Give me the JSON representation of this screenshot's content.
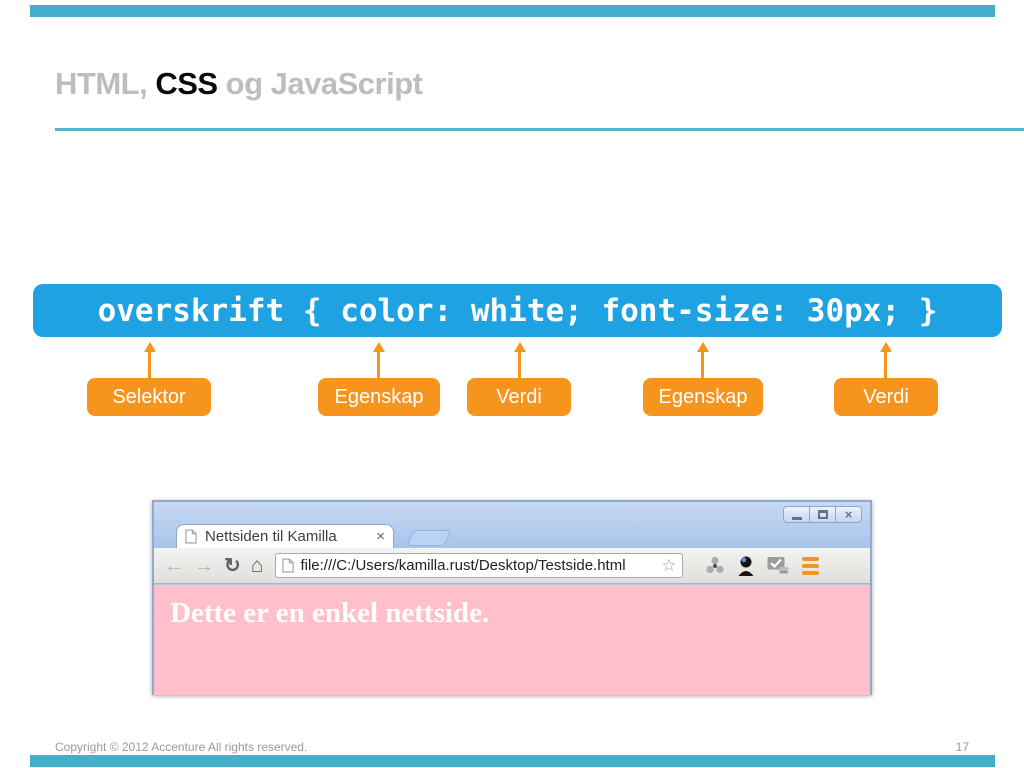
{
  "slide": {
    "title": {
      "part1": "HTML, ",
      "part2": "CSS",
      "part3": " og JavaScript"
    },
    "footer": {
      "copyright": "Copyright © 2012 Accenture  All rights reserved.",
      "page_number": "17"
    },
    "colors": {
      "accent_teal": "#44AFC8",
      "code_blue": "#1EA2E2",
      "label_orange": "#F7941E",
      "page_pink": "#FFC0CB"
    }
  },
  "code_bar": {
    "text": "overskrift { color: white; font-size: 30px; }"
  },
  "labels": [
    {
      "text": "Selektor"
    },
    {
      "text": "Egenskap"
    },
    {
      "text": "Verdi"
    },
    {
      "text": "Egenskap"
    },
    {
      "text": "Verdi"
    }
  ],
  "browser": {
    "tab": {
      "title": "Nettsiden til Kamilla"
    },
    "toolbar": {
      "url": "file:///C:/Users/kamilla.rust/Desktop/Testside.html"
    },
    "page": {
      "text": "Dette er en enkel nettside."
    },
    "icons": {
      "back": "←",
      "forward": "→",
      "reload": "↻",
      "home": "⌂",
      "star": "☆",
      "tab_close": "×",
      "window_close": "×",
      "names": [
        "document-icon",
        "radiation-icon",
        "incognito-person-icon",
        "mail-check-icon",
        "menu-icon"
      ]
    }
  }
}
